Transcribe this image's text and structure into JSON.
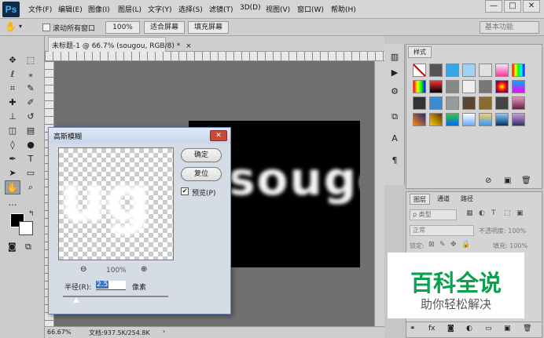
{
  "app": {
    "logo": "Ps"
  },
  "menu": [
    "文件(F)",
    "编辑(E)",
    "图像(I)",
    "图层(L)",
    "文字(Y)",
    "选择(S)",
    "滤镜(T)",
    "3D(D)",
    "视图(V)",
    "窗口(W)",
    "帮助(H)"
  ],
  "window_controls": {
    "minimize": "—",
    "maximize": "□",
    "close": "✕"
  },
  "options": {
    "scroll_all_label": "滚动所有窗口",
    "zoom_value": "100%",
    "fit_screen": "适合屏幕",
    "fill_screen": "填充屏幕",
    "workspace": "基本功能"
  },
  "document": {
    "tab_title": "未标题-1 @ 66.7% (sougou, RGB/8) *",
    "tab_close": "×",
    "canvas_text": "sougou"
  },
  "status": {
    "zoom": "66.67%",
    "doc": "文档:937.5K/254.8K"
  },
  "panels": {
    "styles_tab": "样式",
    "layers_tabs": [
      "图层",
      "通道",
      "路径"
    ],
    "kind_label": "ρ 类型",
    "blend_mode": "正常",
    "opacity_label": "不透明度: 100%",
    "lock_label": "锁定:",
    "fill_label": "填充: 100%"
  },
  "dialog": {
    "title": "高斯模糊",
    "close": "✕",
    "ok": "确定",
    "reset": "复位",
    "preview_label": "预览(P)",
    "preview_checked": true,
    "preview_text": "ug",
    "zoom_level": "100%",
    "radius_label": "半径(R):",
    "radius_value": "2.5",
    "unit": "像素"
  },
  "watermark": {
    "title": "百科全说",
    "subtitle": "助你轻松解决"
  },
  "colors": {
    "accent": "#0aa04c",
    "canvas_bg": "#000000",
    "dialog_title_bg": "#c7d5ea"
  }
}
